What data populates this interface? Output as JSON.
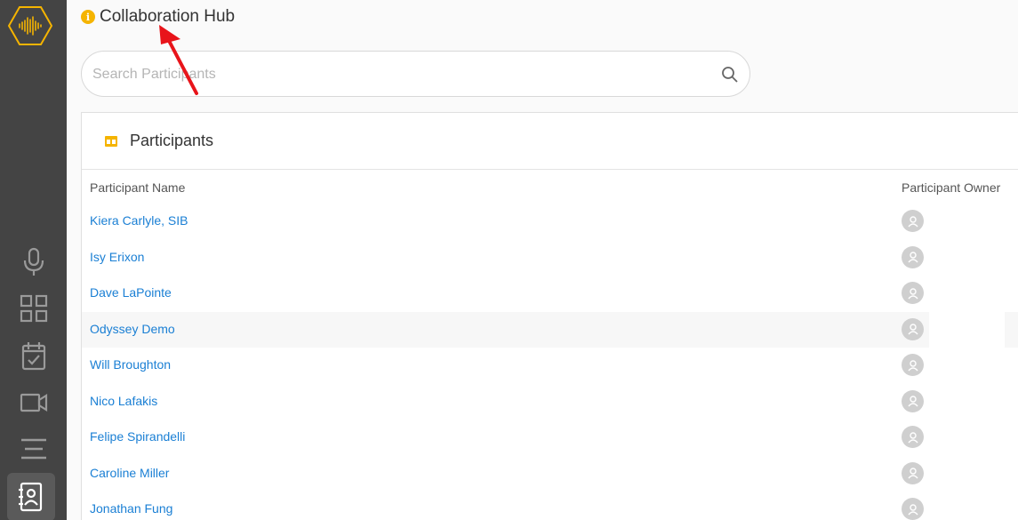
{
  "header": {
    "title": "Collaboration Hub"
  },
  "search": {
    "placeholder": "Search Participants",
    "value": ""
  },
  "panel": {
    "title": "Participants"
  },
  "table": {
    "columns": [
      "Participant Name",
      "Participant Owner"
    ],
    "rows": [
      {
        "name": "Kiera Carlyle, SIB"
      },
      {
        "name": "Isy Erixon"
      },
      {
        "name": "Dave LaPointe"
      },
      {
        "name": "Odyssey Demo"
      },
      {
        "name": "Will Broughton"
      },
      {
        "name": "Nico Lafakis"
      },
      {
        "name": "Felipe Spirandelli"
      },
      {
        "name": "Caroline Miller"
      },
      {
        "name": "Jonathan Fung"
      }
    ]
  },
  "colors": {
    "sidebar": "#444444",
    "accent": "#f5b400",
    "link": "#1a7fd4",
    "annotation_arrow": "#e8141a"
  },
  "icons": [
    "logo-icon",
    "microphone-icon",
    "grid-icon",
    "calendar-check-icon",
    "video-icon",
    "menu-icon",
    "contacts-icon",
    "info-icon",
    "search-icon",
    "table-icon",
    "user-avatar-icon"
  ]
}
